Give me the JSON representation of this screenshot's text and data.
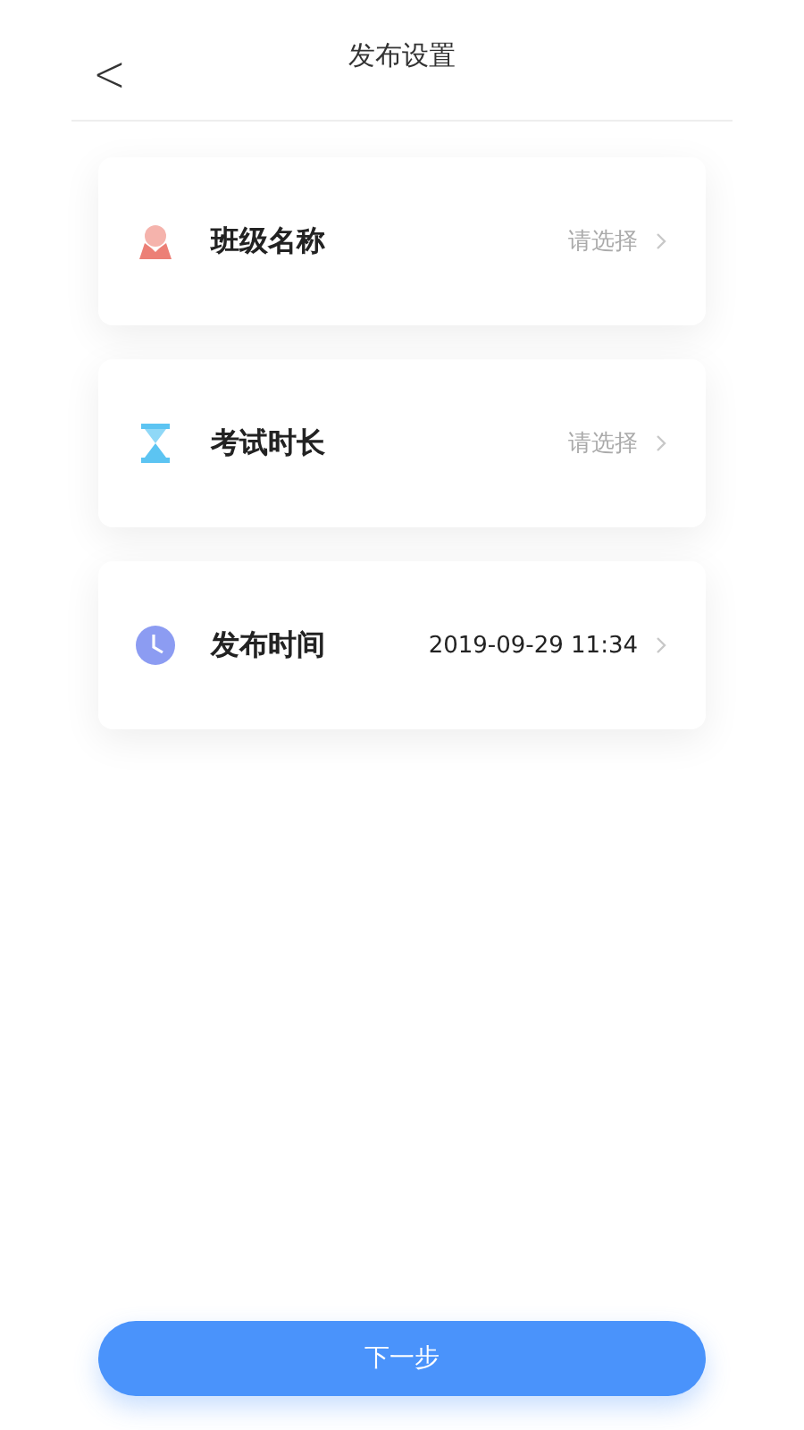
{
  "header": {
    "back": "<",
    "title": "发布设置"
  },
  "rows": [
    {
      "kind": "class",
      "label": "班级名称",
      "placeholder": "请选择"
    },
    {
      "kind": "duration",
      "label": "考试时长",
      "placeholder": "请选择"
    },
    {
      "kind": "time",
      "label": "发布时间",
      "value": "2019-09-29 11:34"
    }
  ],
  "next_button": "下一步"
}
